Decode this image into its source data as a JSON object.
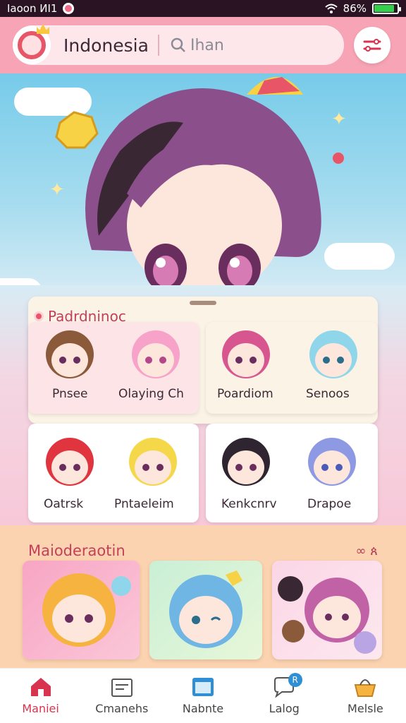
{
  "status_bar": {
    "left_text": "Iaoon ИI1",
    "battery_percent": "86%",
    "battery_level": 0.86
  },
  "header": {
    "region": "Indonesia",
    "search_placeholder": "Ihan"
  },
  "categories": {
    "title": "Padrdninoc",
    "cards": [
      {
        "labels": [
          "Pnsee",
          "Olaying Ch"
        ]
      },
      {
        "labels": [
          "Poardiom",
          "Senoos"
        ]
      },
      {
        "labels": [
          "Oatrsk",
          "Pntaeleim"
        ]
      },
      {
        "labels": [
          "Kenkcnrv",
          "Drapoe"
        ]
      }
    ]
  },
  "section": {
    "title": "Maioderaotin",
    "more": "∞ ጰ"
  },
  "bottom_nav": [
    {
      "label": "Maniei",
      "icon": "home-icon",
      "active": true
    },
    {
      "label": "Cmanehs",
      "icon": "cards-icon",
      "active": false
    },
    {
      "label": "Nabnte",
      "icon": "window-icon",
      "active": false
    },
    {
      "label": "Lalog",
      "icon": "chat-icon",
      "active": false,
      "badge": "R"
    },
    {
      "label": "Melsle",
      "icon": "basket-icon",
      "active": false
    }
  ],
  "colors": {
    "accent": "#d9344f",
    "header": "#f7a4b6",
    "sky": "#76cbe9",
    "section": "#fcd3b0"
  }
}
